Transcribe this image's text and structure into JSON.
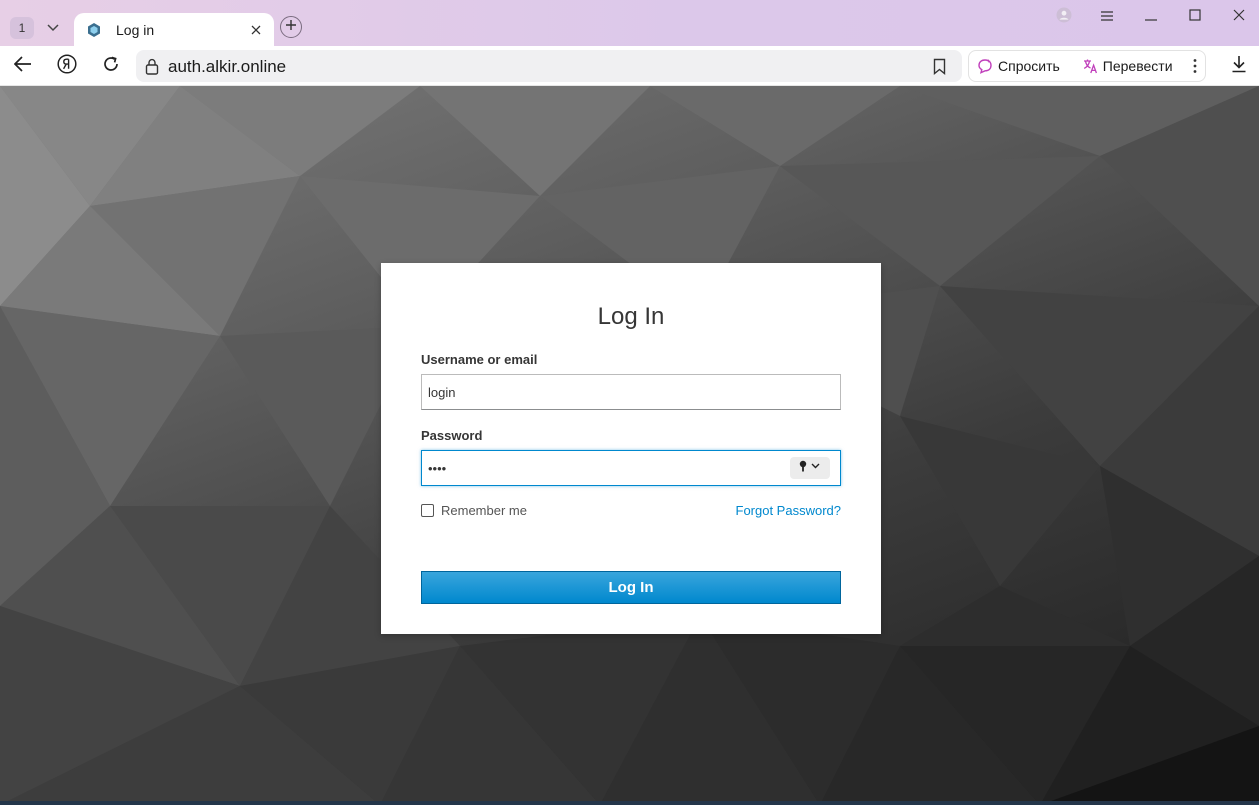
{
  "browser": {
    "tab_count": "1",
    "tab": {
      "title": "Log in",
      "favicon": "site-favicon"
    },
    "url": "auth.alkir.online",
    "assist": {
      "ask_label": "Спросить",
      "translate_label": "Перевести"
    },
    "icons": [
      "tab-list-icon",
      "close-icon",
      "plus-icon",
      "profile-icon",
      "menu-icon",
      "minimize-icon",
      "maximize-icon",
      "close-window-icon",
      "back-icon",
      "yandex-icon",
      "reload-icon",
      "lock-icon",
      "bookmark-icon",
      "more-icon",
      "download-icon"
    ]
  },
  "login": {
    "title": "Log In",
    "username_label": "Username or email",
    "username_value": "login",
    "password_label": "Password",
    "password_value": "••••",
    "remember_label": "Remember me",
    "remember_checked": false,
    "forgot_label": "Forgot Password?",
    "submit_label": "Log In"
  },
  "colors": {
    "accent": "#0088ce",
    "button_top": "#39a5dc",
    "titlebar": "#e2cce8"
  }
}
